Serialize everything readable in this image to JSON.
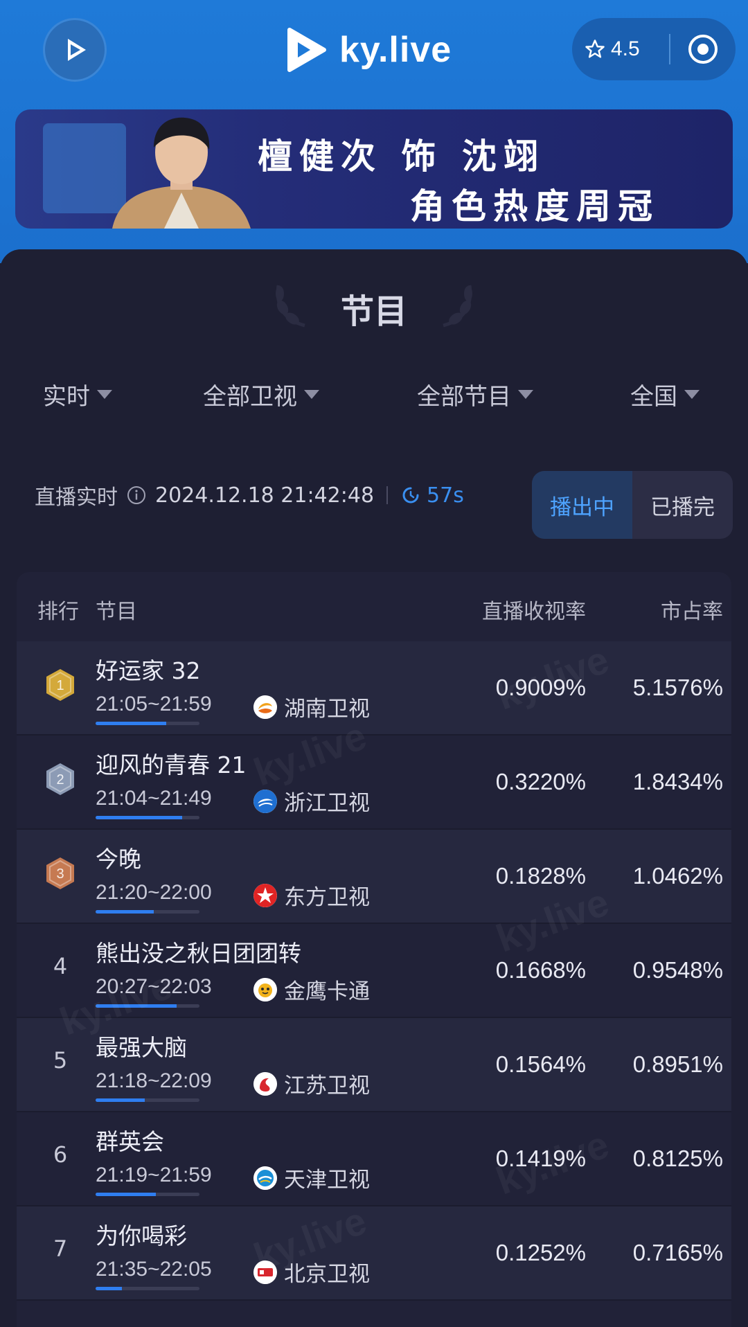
{
  "header": {
    "brand": "ky.live",
    "rating": "4.5"
  },
  "banner": {
    "line1": "檀健次 饰 沈翊",
    "line2": "角色热度周冠"
  },
  "section": {
    "title": "节目"
  },
  "filters": [
    "实时",
    "全部卫视",
    "全部节目",
    "全国"
  ],
  "status": {
    "label": "直播实时",
    "datetime": "2024.12.18 21:42:48",
    "countdown": "57s"
  },
  "toggle": {
    "on_air": "播出中",
    "finished": "已播完"
  },
  "table": {
    "headers": {
      "rank": "排行",
      "program": "节目",
      "rating": "直播收视率",
      "share": "市占率"
    },
    "rows": [
      {
        "rank": "1",
        "name": "好运家 32",
        "time": "21:05~21:59",
        "channel": "湖南卫视",
        "rating": "0.9009%",
        "share": "5.1576%",
        "progress": 0.68
      },
      {
        "rank": "2",
        "name": "迎风的青春 21",
        "time": "21:04~21:49",
        "channel": "浙江卫视",
        "rating": "0.3220%",
        "share": "1.8434%",
        "progress": 0.83
      },
      {
        "rank": "3",
        "name": "今晚",
        "time": "21:20~22:00",
        "channel": "东方卫视",
        "rating": "0.1828%",
        "share": "1.0462%",
        "progress": 0.56
      },
      {
        "rank": "4",
        "name": "熊出没之秋日团团转",
        "time": "20:27~22:03",
        "channel": "金鹰卡通",
        "rating": "0.1668%",
        "share": "0.9548%",
        "progress": 0.78
      },
      {
        "rank": "5",
        "name": "最强大脑",
        "time": "21:18~22:09",
        "channel": "江苏卫视",
        "rating": "0.1564%",
        "share": "0.8951%",
        "progress": 0.47
      },
      {
        "rank": "6",
        "name": "群英会",
        "time": "21:19~21:59",
        "channel": "天津卫视",
        "rating": "0.1419%",
        "share": "0.8125%",
        "progress": 0.58
      },
      {
        "rank": "7",
        "name": "为你喝彩",
        "time": "21:35~22:05",
        "channel": "北京卫视",
        "rating": "0.1252%",
        "share": "0.7165%",
        "progress": 0.25
      }
    ]
  },
  "colors": {
    "header_bg": "#1f7ad8",
    "page_bg": "#1e1f33",
    "accent": "#2f7ef0",
    "gold": "#d4a93a",
    "silver": "#8c9bb5",
    "bronze": "#c67a52"
  }
}
